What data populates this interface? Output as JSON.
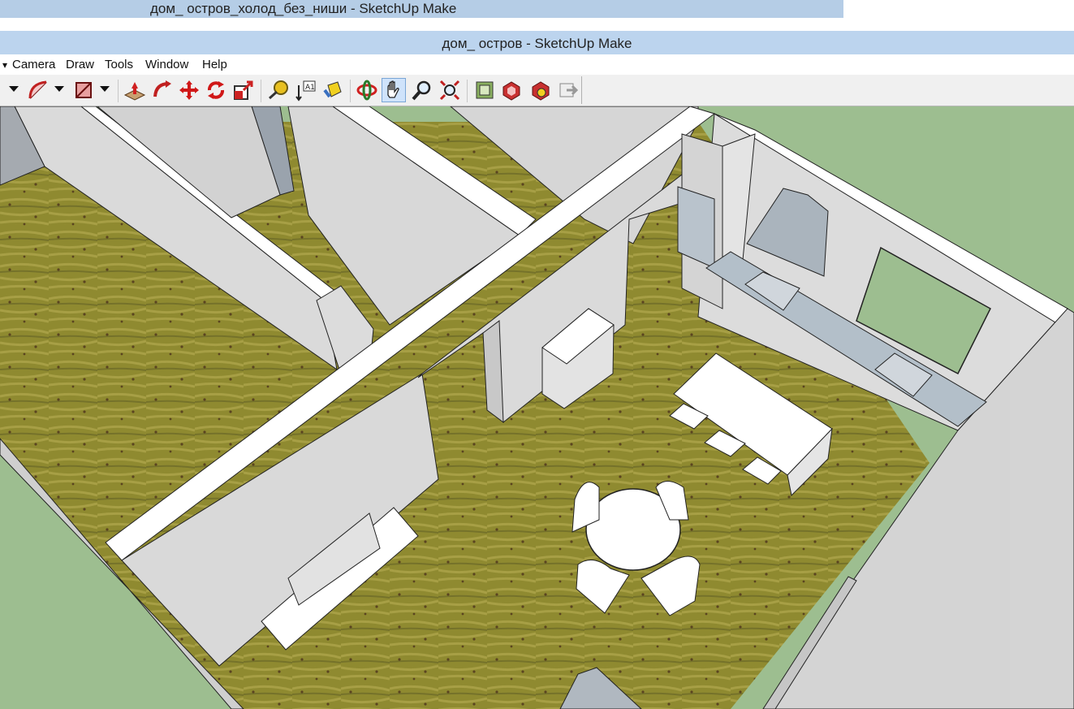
{
  "background_window": {
    "title": "дом_ остров_холод_без_ниши - SketchUp Make"
  },
  "window": {
    "title": "дом_ остров - SketchUp Make"
  },
  "menu": {
    "items": [
      "Camera",
      "Draw",
      "Tools",
      "Window",
      "Help"
    ]
  },
  "toolbar": {
    "tools": [
      "select-icon",
      "arc-icon",
      "eraser-icon",
      "push-pull-icon",
      "follow-me-icon",
      "move-icon",
      "rotate-icon",
      "scale-icon",
      "tape-measure-icon",
      "text-icon",
      "paint-bucket-icon",
      "orbit-icon",
      "pan-icon",
      "zoom-icon",
      "zoom-extents-icon",
      "get-models-icon",
      "share-model-icon",
      "extension-warehouse-icon",
      "send-to-layout-icon"
    ],
    "active_tool": "pan-icon"
  },
  "viewport": {
    "colors": {
      "ground": "#9dbe90",
      "wall": "#dcdcdc",
      "wall_shade": "#c9c9c9",
      "wall_top": "#ffffff",
      "floor": "#8a8a2e"
    }
  }
}
